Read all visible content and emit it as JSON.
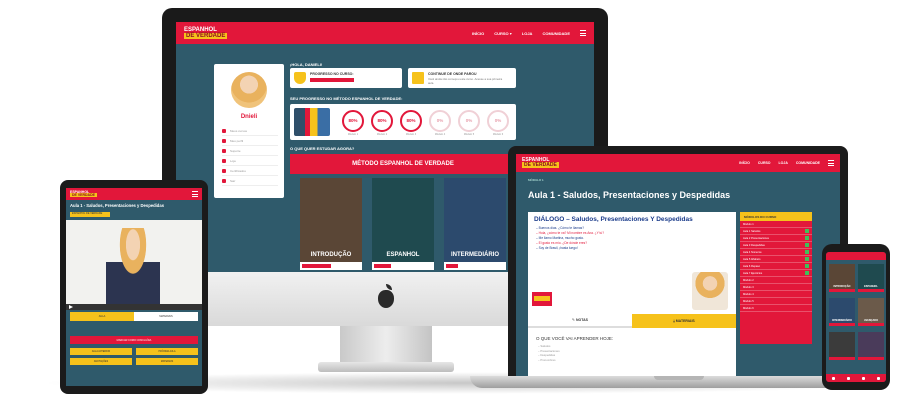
{
  "brand": {
    "logo_line1": "ESPANHOL",
    "logo_line2": "DE VERDADE",
    "primary": "#e2173a",
    "accent": "#f6c21b",
    "background": "#2f5a6b"
  },
  "dashboard": {
    "nav": [
      "INÍCIO",
      "CURSO ▾",
      "LOJA",
      "COMUNIDADE"
    ],
    "greeting": "¡HOLA, DANIELI!",
    "user_name": "Dnieli",
    "profile_menu": [
      "Meus cursos",
      "Meu perfil",
      "Suporte",
      "Loja",
      "Certificados",
      "Sair"
    ],
    "course_box": {
      "icon": "trophy-icon",
      "title": "PROGRESSO NO CURSO:",
      "progress": 0.55
    },
    "continue_box": {
      "icon": "monitor-icon",
      "title": "CONTINUE DE ONDE PAROU",
      "text": "Você ainda não começou este curso. Acesse a sua primeira aula."
    },
    "progress_title": "SEU PROGRESSO NO MÉTODO ESPANHOL DE VERDADE:",
    "levels": [
      {
        "pct": "80%",
        "label": "Módulo 1",
        "active": true
      },
      {
        "pct": "80%",
        "label": "Módulo 2",
        "active": true
      },
      {
        "pct": "80%",
        "label": "Módulo 3",
        "active": true
      },
      {
        "pct": "0%",
        "label": "Módulo 4",
        "active": false
      },
      {
        "pct": "0%",
        "label": "Módulo 5",
        "active": false
      },
      {
        "pct": "0%",
        "label": "Módulo 6",
        "active": false
      }
    ],
    "study_label": "O QUE QUER ESTUDAR AGORA?",
    "banner": "MÉTODO ESPANHOL DE VERDADE",
    "courses": [
      {
        "title": "INTRODUÇÃO",
        "progress": 0.5,
        "bg": "#5a4636"
      },
      {
        "title": "ESPANHOL",
        "progress": 0.3,
        "bg": "#1f4a4f"
      },
      {
        "title": "INTERMEDIÁRIO",
        "progress": 0.2,
        "bg": "#2c4a6d"
      }
    ]
  },
  "lesson": {
    "nav": [
      "INÍCIO",
      "CURSO",
      "LOJA",
      "COMUNIDADE"
    ],
    "breadcrumb": "MÓDULO 1",
    "title": "Aula 1 - Saludos, Presentaciones y Despedidas",
    "dialog_title": "DIÁLOGO – Saludos, Presentaciones Y Despedidas",
    "dialog_lines": [
      "– Buenos días. ¿Cómo te llamas?",
      "– Hola, ¿cómo te va? Mi nombre es Ana. ¿Y tú?",
      "– Me llamo Martina, mucho gusto.",
      "– El gusto es mío. ¿De dónde eres?",
      "– Soy de Brasil, ¡hasta luego!"
    ],
    "tab_notes": "NOTAS",
    "tab_material": "MATERIAIS",
    "learn_title": "O QUE VOCÊ VAI APRENDER HOJE:",
    "learn_items": [
      "– Saludos",
      "– Presentaciones",
      "– Despedidas",
      "– Pronombres"
    ],
    "modules_head": "MÓDULOS DO CURSO",
    "modules": [
      {
        "label": "Módulo 1",
        "done": false
      },
      {
        "label": "Aula 1 Saludos",
        "done": true
      },
      {
        "label": "Aula 2 Presentaciones",
        "done": true
      },
      {
        "label": "Aula 3 Despedidas",
        "done": true
      },
      {
        "label": "Aula 4 Números",
        "done": true
      },
      {
        "label": "Aula 5 Alfabeto",
        "done": true
      },
      {
        "label": "Aula 6 Repaso",
        "done": true
      },
      {
        "label": "Aula 7 Ejercicios",
        "done": true
      },
      {
        "label": "Módulo 2",
        "done": false
      },
      {
        "label": "Módulo 3",
        "done": false
      },
      {
        "label": "Módulo 4",
        "done": false
      },
      {
        "label": "Módulo 5",
        "done": false
      },
      {
        "label": "Módulo 6",
        "done": false
      }
    ]
  },
  "tablet": {
    "title": "Aula 1 - Saludos, Presentaciones y Despedidas",
    "strip": "ESPANHOL DE VERDADE",
    "tabs": [
      "AULA",
      "MATERIAIS"
    ],
    "primary_button": "MARCAR COMO CONCLUÍDA",
    "buttons": [
      "AULA ANTERIOR",
      "PRÓXIMA AULA",
      "ANOTAÇÕES",
      "MATERIAIS"
    ]
  },
  "phone": {
    "cards": [
      "INTRODUÇÃO",
      "ESPANHOL",
      "INTERMEDIÁRIO",
      "AVANÇADO",
      "",
      ""
    ]
  }
}
